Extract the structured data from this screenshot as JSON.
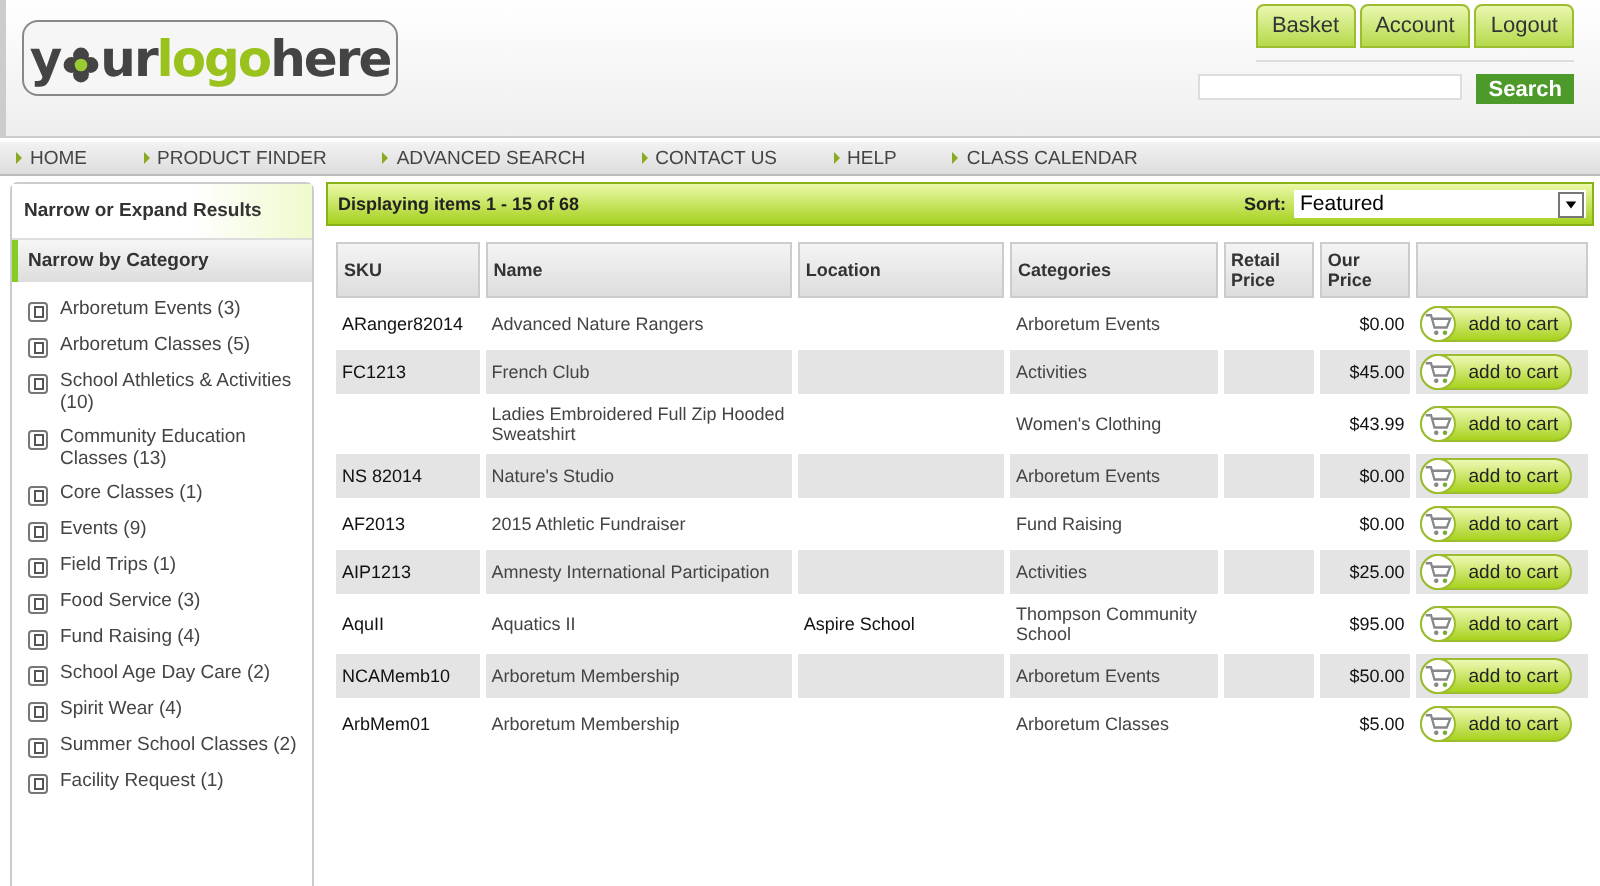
{
  "logo": {
    "start": "y",
    "end": "ur",
    "accent": "logo",
    "tail": "here"
  },
  "account_buttons": [
    "Basket",
    "Account",
    "Logout"
  ],
  "search": {
    "button": "Search"
  },
  "nav": [
    "HOME",
    "PRODUCT FINDER",
    "ADVANCED SEARCH",
    "CONTACT US",
    "HELP",
    "CLASS CALENDAR"
  ],
  "sidebar": {
    "title": "Narrow or Expand Results",
    "section": "Narrow by Category",
    "categories": [
      {
        "label": "Arboretum Events (3)"
      },
      {
        "label": "Arboretum Classes (5)"
      },
      {
        "label": "School Athletics & Activities (10)"
      },
      {
        "label": "Community Education Classes (13)"
      },
      {
        "label": "Core Classes (1)"
      },
      {
        "label": "Events (9)"
      },
      {
        "label": "Field Trips (1)"
      },
      {
        "label": "Food Service (3)"
      },
      {
        "label": "Fund Raising (4)"
      },
      {
        "label": "School Age Day Care (2)"
      },
      {
        "label": "Spirit Wear (4)"
      },
      {
        "label": "Summer School Classes (2)"
      },
      {
        "label": "Facility Request (1)"
      }
    ]
  },
  "results": {
    "summary": "Displaying items 1 - 15 of 68",
    "sort_label": "Sort:",
    "sort_value": "Featured"
  },
  "table": {
    "columns": [
      "SKU",
      "Name",
      "Location",
      "Categories",
      "Retail Price",
      "Our Price"
    ],
    "rows": [
      {
        "sku": "ARanger82014",
        "name": "Advanced Nature Rangers",
        "location": "",
        "category": "Arboretum Events",
        "retail": "",
        "price": "$0.00",
        "button": "add to cart"
      },
      {
        "sku": "FC1213",
        "name": "French Club",
        "location": "",
        "category": "Activities",
        "retail": "",
        "price": "$45.00",
        "button": "add to cart"
      },
      {
        "sku": "",
        "name": "Ladies Embroidered Full Zip Hooded Sweatshirt",
        "location": "",
        "category": "Women's Clothing",
        "retail": "",
        "price": "$43.99",
        "button": "add to cart"
      },
      {
        "sku": "NS 82014",
        "name": "Nature's Studio",
        "location": "",
        "category": "Arboretum Events",
        "retail": "",
        "price": "$0.00",
        "button": "add to cart"
      },
      {
        "sku": "AF2013",
        "name": "2015 Athletic Fundraiser",
        "location": "",
        "category": "Fund Raising",
        "retail": "",
        "price": "$0.00",
        "button": "add to cart"
      },
      {
        "sku": "AIP1213",
        "name": "Amnesty International Participation",
        "location": "",
        "category": "Activities",
        "retail": "",
        "price": "$25.00",
        "button": "add to cart"
      },
      {
        "sku": "AquII",
        "name": "Aquatics II",
        "location": "Aspire School",
        "category": "Thompson Community School",
        "retail": "",
        "price": "$95.00",
        "button": "add to cart"
      },
      {
        "sku": "NCAMemb10",
        "name": "Arboretum Membership",
        "location": "",
        "category": "Arboretum Events",
        "retail": "",
        "price": "$50.00",
        "button": "add to cart"
      },
      {
        "sku": "ArbMem01",
        "name": "Arboretum Membership",
        "location": "",
        "category": "Arboretum Classes",
        "retail": "",
        "price": "$5.00",
        "button": "add to cart"
      }
    ]
  }
}
